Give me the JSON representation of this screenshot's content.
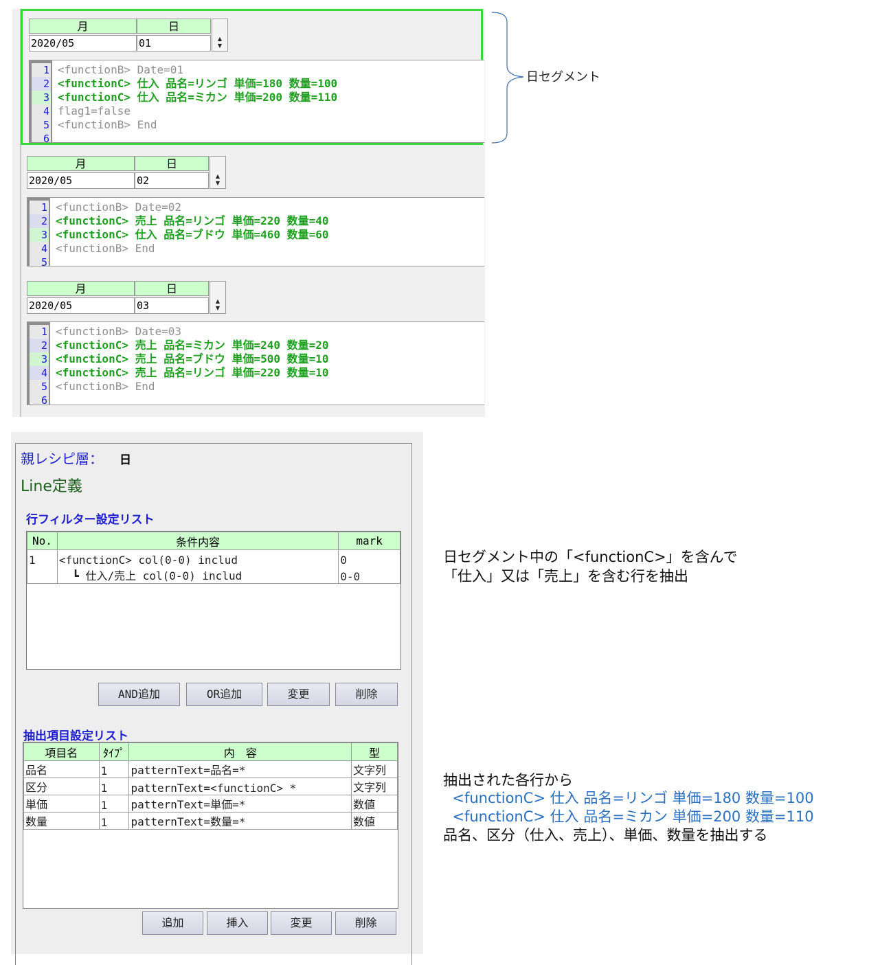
{
  "segments": [
    {
      "month_header": "月",
      "day_header": "日",
      "month_value": "2020/05",
      "day_value": "01",
      "lines": [
        {
          "no": "1",
          "text": "<functionB> Date=01",
          "style": "gray"
        },
        {
          "no": "2",
          "text": "<functionC> 仕入 品名=リンゴ 単価=180 数量=100",
          "style": "green"
        },
        {
          "no": "3",
          "text": "<functionC> 仕入 品名=ミカン 単価=200 数量=110",
          "style": "green"
        },
        {
          "no": "4",
          "text": "flag1=false",
          "style": "gray"
        },
        {
          "no": "5",
          "text": "<functionB> End",
          "style": "gray"
        },
        {
          "no": "6",
          "text": "",
          "style": "gray"
        }
      ]
    },
    {
      "month_header": "月",
      "day_header": "日",
      "month_value": "2020/05",
      "day_value": "02",
      "lines": [
        {
          "no": "1",
          "text": "<functionB> Date=02",
          "style": "gray"
        },
        {
          "no": "2",
          "text": "<functionC> 売上 品名=リンゴ 単価=220 数量=40",
          "style": "green"
        },
        {
          "no": "3",
          "text": "<functionC> 仕入 品名=ブドウ 単価=460 数量=60",
          "style": "green"
        },
        {
          "no": "4",
          "text": "<functionB> End",
          "style": "gray"
        },
        {
          "no": "5",
          "text": "",
          "style": "gray"
        }
      ]
    },
    {
      "month_header": "月",
      "day_header": "日",
      "month_value": "2020/05",
      "day_value": "03",
      "lines": [
        {
          "no": "1",
          "text": "<functionB> Date=03",
          "style": "gray"
        },
        {
          "no": "2",
          "text": "<functionC> 売上 品名=ミカン 単価=240 数量=20",
          "style": "green"
        },
        {
          "no": "3",
          "text": "<functionC> 売上 品名=ブドウ 単価=500 数量=10",
          "style": "green"
        },
        {
          "no": "4",
          "text": "<functionC> 売上 品名=リンゴ 単価=220 数量=10",
          "style": "green"
        },
        {
          "no": "5",
          "text": "<functionB> End",
          "style": "gray"
        },
        {
          "no": "6",
          "text": "",
          "style": "gray"
        }
      ]
    }
  ],
  "brace_label": "日セグメント",
  "recipe": {
    "parent_label": "親レシピ層：",
    "parent_value": "日",
    "line_def": "Line定義",
    "filter_title": "行フィルター設定リスト",
    "filter_headers": [
      "No.",
      "条件内容",
      "mark"
    ],
    "filter_rows": [
      [
        "1",
        "<functionC> col(0-0) includ",
        "0"
      ],
      [
        "",
        "  ┗ 仕入/売上 col(0-0) includ",
        "0-0"
      ]
    ],
    "filter_buttons": [
      "AND追加",
      "OR追加",
      "変更",
      "削除"
    ],
    "extract_title": "抽出項目設定リスト",
    "extract_headers": [
      "項目名",
      "ﾀｲﾌﾟ",
      "内　容",
      "型"
    ],
    "extract_rows": [
      [
        "品名",
        "1",
        "patternText=品名=*",
        "文字列"
      ],
      [
        "区分",
        "1",
        "patternText=<functionC> *",
        "文字列"
      ],
      [
        "単価",
        "1",
        "patternText=単価=*",
        "数値"
      ],
      [
        "数量",
        "1",
        "patternText=数量=*",
        "数値"
      ]
    ],
    "extract_buttons": [
      "追加",
      "挿入",
      "変更",
      "削除"
    ]
  },
  "notes": {
    "filter_note_1": "日セグメント中の「<functionC>」を含んで",
    "filter_note_2": "「仕入」又は「売上」を含む行を抽出",
    "extract_note_1": "抽出された各行から",
    "extract_note_2": "  <functionC> 仕入 品名=リンゴ 単価=180 数量=100",
    "extract_note_3": "  <functionC> 仕入 品名=ミカン 単価=200 数量=110",
    "extract_note_4": "品名、区分（仕入、売上）、単価、数量を抽出する"
  },
  "colors": {
    "header_green": "#ccffcc",
    "selection_border": "#39d839",
    "code_green": "#1f9f1f",
    "note_blue": "#2a6fc0"
  }
}
